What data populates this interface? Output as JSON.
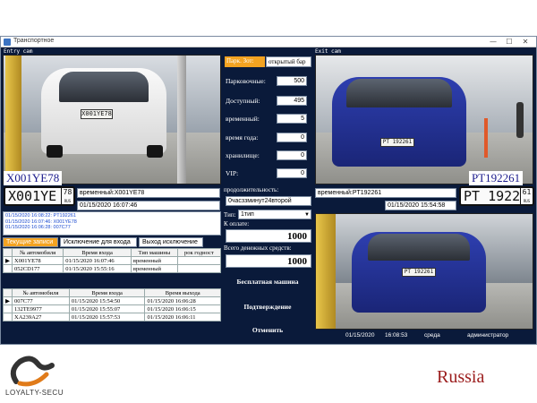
{
  "window": {
    "title": "Транспортное",
    "minimize_icon": "—",
    "maximize_icon": "☐",
    "close_icon": "✕"
  },
  "labels": {
    "entry_cam": "Entry cam",
    "exit_cam": "Exit cam"
  },
  "entry": {
    "plate_recognized": "X001YE78",
    "plate_image_main": "X001YE",
    "plate_image_region": "78",
    "plate_image_country": "RUS",
    "time_field": "временный:X001YE78",
    "date_field": "01/15/2020 16:07:46"
  },
  "exit": {
    "plate_recognized": "PT192261",
    "plate_image_main": "PT 1922",
    "plate_image_region": "61",
    "plate_image_country": "RUS",
    "time_field": "временный:PT192261",
    "date_field": "01/15/2020 15:54:58"
  },
  "center": {
    "header_left": "Парк. Зот:",
    "header_right": "открытый бар",
    "rows": [
      {
        "label": "Парковочные:",
        "value": "500"
      },
      {
        "label": "Доступный:",
        "value": "495"
      },
      {
        "label": "временный:",
        "value": "5"
      },
      {
        "label": "время года:",
        "value": "0"
      },
      {
        "label": "хранилище:",
        "value": "0"
      },
      {
        "label": "VIP:",
        "value": "0"
      }
    ],
    "duration_label": "продолжительность:",
    "duration_value": "0часззминут24второй",
    "type_label": "Тип:",
    "type_value": "1тип",
    "pay_label": "К оплате:",
    "pay_value": "1000",
    "total_label": "Всего денежных средств:",
    "total_value": "1000",
    "btn_free": "Бесплатная машина",
    "btn_confirm": "Подтверждение",
    "btn_cancel": "Отменить"
  },
  "log_lines": [
    "01/15/2020 16:08:22: PT192261",
    "01/15/2020 16:07:46: X001YE78",
    "01/15/2020 16:06:28: 007C77"
  ],
  "tabs": [
    {
      "label": "Текущие записи"
    },
    {
      "label": "Исключение для входа"
    },
    {
      "label": "Выход исключение"
    }
  ],
  "table_current": {
    "headers": [
      "№ автомобиля",
      "Время входа",
      "Тип машины",
      "рок годност"
    ],
    "rows": [
      [
        "X001YE78",
        "01/15/2020 16:07:46",
        "временный",
        ""
      ],
      [
        "052CD177",
        "01/15/2020 15:55:16",
        "временный",
        ""
      ]
    ]
  },
  "table_history": {
    "headers": [
      "№ автомобиля",
      "Время входа",
      "Время выхода"
    ],
    "rows": [
      [
        "007C77",
        "01/15/2020 15:54:50",
        "01/15/2020 16:06:28"
      ],
      [
        "132TE9977",
        "01/15/2020 15:55:07",
        "01/15/2020 16:06:15"
      ],
      [
        "XA239A27",
        "01/15/2020 15:57:53",
        "01/15/2020 16:06:11"
      ]
    ]
  },
  "status": {
    "date": "01/15/2020",
    "time": "16:08:53",
    "day": "среда",
    "user": "администратор"
  },
  "brand": {
    "logo_text": "LOYALTY-SECU",
    "country": "Russia"
  }
}
